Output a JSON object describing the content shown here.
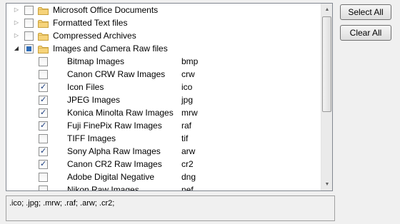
{
  "tree": {
    "categories": [
      {
        "label": "Microsoft Office Documents",
        "expanded": false,
        "check_state": "unchecked"
      },
      {
        "label": "Formatted Text files",
        "expanded": false,
        "check_state": "unchecked"
      },
      {
        "label": "Compressed Archives",
        "expanded": false,
        "check_state": "unchecked"
      },
      {
        "label": "Images and Camera Raw files",
        "expanded": true,
        "check_state": "partial"
      }
    ],
    "file_types": [
      {
        "label": "Bitmap Images",
        "ext": "bmp",
        "checked": false
      },
      {
        "label": "Canon CRW Raw Images",
        "ext": "crw",
        "checked": false
      },
      {
        "label": "Icon Files",
        "ext": "ico",
        "checked": true
      },
      {
        "label": "JPEG Images",
        "ext": "jpg",
        "checked": true
      },
      {
        "label": "Konica Minolta Raw Images",
        "ext": "mrw",
        "checked": true
      },
      {
        "label": "Fuji FinePix Raw Images",
        "ext": "raf",
        "checked": true
      },
      {
        "label": "TIFF Images",
        "ext": "tif",
        "checked": false
      },
      {
        "label": "Sony Alpha Raw Images",
        "ext": "arw",
        "checked": true
      },
      {
        "label": "Canon CR2 Raw Images",
        "ext": "cr2",
        "checked": true
      },
      {
        "label": "Adobe Digital Negative",
        "ext": "dng",
        "checked": false
      },
      {
        "label": "Nikon Raw Images",
        "ext": "nef",
        "checked": false
      }
    ]
  },
  "buttons": {
    "select_all": "Select All",
    "clear_all": "Clear All"
  },
  "output": {
    "text": ".ico; .jpg; .mrw; .raf; .arw; .cr2;"
  },
  "icons": {
    "folder": "folder-icon",
    "expand": "triangle-right-icon",
    "collapse": "triangle-down-icon",
    "check": "checkmark-icon"
  },
  "colors": {
    "folder_fill": "#f6d37a",
    "folder_stroke": "#c9a13c",
    "partial_fill": "#2d6bb7",
    "tick": "#1d3f81"
  }
}
